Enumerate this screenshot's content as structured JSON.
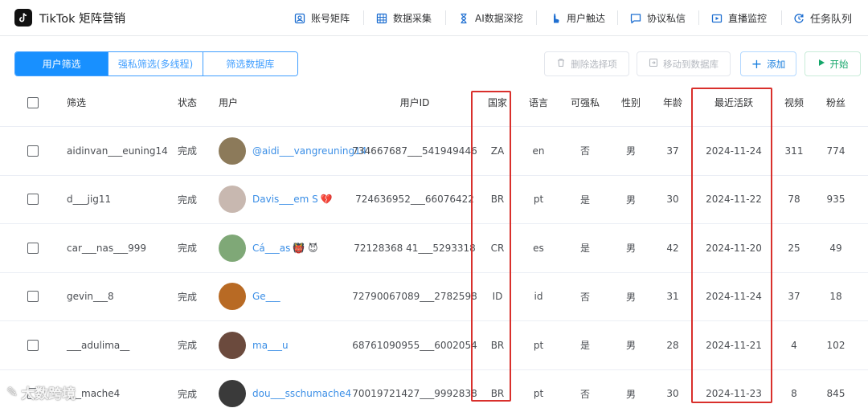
{
  "app": {
    "title": "TikTok 矩阵营销"
  },
  "nav": [
    {
      "label": "账号矩阵",
      "icon": "account-matrix-icon"
    },
    {
      "label": "数据采集",
      "icon": "data-collect-icon"
    },
    {
      "label": "AI数据深挖",
      "icon": "ai-hourglass-icon"
    },
    {
      "label": "用户触达",
      "icon": "user-reach-icon"
    },
    {
      "label": "协议私信",
      "icon": "message-icon"
    },
    {
      "label": "直播监控",
      "icon": "live-monitor-icon"
    },
    {
      "label": "任务队列",
      "icon": "task-queue-icon"
    }
  ],
  "tabs": [
    {
      "label": "用户筛选",
      "active": true
    },
    {
      "label": "强私筛选(多线程)",
      "active": false
    },
    {
      "label": "筛选数据库",
      "active": false
    }
  ],
  "actions": {
    "delete_label": "删除选择项",
    "move_label": "移动到数据库",
    "add_label": "添加",
    "start_label": "开始"
  },
  "table": {
    "headers": {
      "filter": "筛选",
      "status": "状态",
      "user": "用户",
      "user_id": "用户ID",
      "country": "国家",
      "language": "语言",
      "dm": "可强私",
      "gender": "性别",
      "age": "年龄",
      "last_active": "最近活跃",
      "videos": "视频",
      "fans": "粉丝"
    },
    "rows": [
      {
        "filter": "aidinvan___euning14",
        "status": "完成",
        "name": "@aidi___vangreuning14",
        "extra": "",
        "user_id": "734667687___541949446",
        "country": "ZA",
        "language": "en",
        "dm": "否",
        "gender": "男",
        "age": "37",
        "last_active": "2024-11-24",
        "videos": "311",
        "fans": "774",
        "avatar": "#8c7a5a"
      },
      {
        "filter": "d___jig11",
        "status": "完成",
        "name": "Davis___em S",
        "extra": "💔",
        "user_id": "724636952___66076422",
        "country": "BR",
        "language": "pt",
        "dm": "是",
        "gender": "男",
        "age": "30",
        "last_active": "2024-11-22",
        "videos": "78",
        "fans": "935",
        "avatar": "#c8b8b0"
      },
      {
        "filter": "car___nas___999",
        "status": "完成",
        "name": "Cá___as",
        "extra": "👹 😈",
        "user_id": "72128368 41___5293318",
        "country": "CR",
        "language": "es",
        "dm": "是",
        "gender": "男",
        "age": "42",
        "last_active": "2024-11-20",
        "videos": "25",
        "fans": "49",
        "avatar": "#7fa877"
      },
      {
        "filter": "gevin___8",
        "status": "完成",
        "name": "Ge___",
        "extra": "",
        "user_id": "72790067089___2782598",
        "country": "ID",
        "language": "id",
        "dm": "否",
        "gender": "男",
        "age": "31",
        "last_active": "2024-11-24",
        "videos": "37",
        "fans": "18",
        "avatar": "#b86a24"
      },
      {
        "filter": "___adulima__",
        "status": "完成",
        "name": "ma___u",
        "extra": "",
        "user_id": "68761090955___6002054",
        "country": "BR",
        "language": "pt",
        "dm": "是",
        "gender": "男",
        "age": "28",
        "last_active": "2024-11-21",
        "videos": "4",
        "fans": "102",
        "avatar": "#6b4a3d"
      },
      {
        "filter": "___mache4",
        "status": "完成",
        "name": "dou___sschumache4",
        "extra": "",
        "user_id": "70019721427___9992838",
        "country": "BR",
        "language": "pt",
        "dm": "否",
        "gender": "男",
        "age": "30",
        "last_active": "2024-11-23",
        "videos": "8",
        "fans": "845",
        "avatar": "#3a3a3a"
      }
    ]
  },
  "watermark": "大数跨境"
}
